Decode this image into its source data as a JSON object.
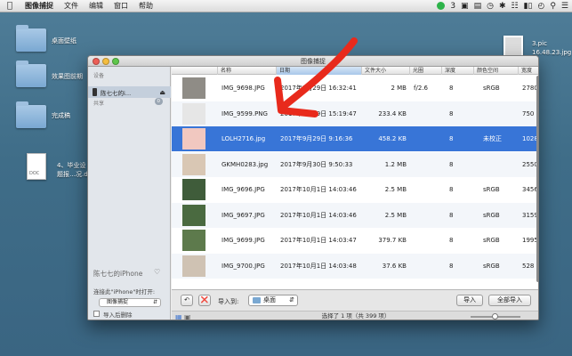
{
  "menubar": {
    "apple": "",
    "items": [
      "图像捕捉",
      "文件",
      "编辑",
      "窗口",
      "帮助"
    ],
    "status_count": "3"
  },
  "desktop": {
    "folders": [
      "桌面壁纸",
      "效果图前期",
      "完成稿"
    ],
    "doc_label_line1": "4、毕业设",
    "doc_label_line2": "题报…况.doc",
    "doc_type": "DOC",
    "screenshot_line1": "3.pic",
    "screenshot_line2": "16.48.23.jpg"
  },
  "window": {
    "title": "图像捕捉",
    "sidebar": {
      "devices_header": "设备",
      "device_name": "陈七七的i…",
      "shared_header": "共享",
      "shared_count": "0",
      "footer_device": "陈七七的iPhone",
      "open_with_label": "连接此\"iPhone\"时打开:",
      "open_with_value": "图像捕捉",
      "delete_after_label": "导入后删除"
    },
    "columns": [
      "名称",
      "日期",
      "文件大小",
      "光圈",
      "深度",
      "颜色空间",
      "宽度"
    ],
    "rows": [
      {
        "name": "IMG_9698.JPG",
        "date": "2017年9月29日 16:32:41",
        "size": "2 MB",
        "aperture": "f/2.6",
        "depth": "8",
        "colorspace": "sRGB",
        "width": "2780",
        "thumb": "#8f8c86"
      },
      {
        "name": "IMG_9599.PNG",
        "date": "2017年9月29日 15:19:47",
        "size": "233.4 KB",
        "aperture": "",
        "depth": "8",
        "colorspace": "",
        "width": "750",
        "thumb": "#e6e6e6"
      },
      {
        "name": "LOLH2716.jpg",
        "date": "2017年9月29日 9:16:36",
        "size": "458.2 KB",
        "aperture": "",
        "depth": "8",
        "colorspace": "未校正",
        "width": "1028",
        "thumb": "#f1c8c0"
      },
      {
        "name": "GKMH0283.jpg",
        "date": "2017年9月30日 9:50:33",
        "size": "1.2 MB",
        "aperture": "",
        "depth": "8",
        "colorspace": "",
        "width": "2550",
        "thumb": "#d9c7b4"
      },
      {
        "name": "IMG_9696.JPG",
        "date": "2017年10月1日 14:03:46",
        "size": "2.5 MB",
        "aperture": "",
        "depth": "8",
        "colorspace": "sRGB",
        "width": "3456",
        "thumb": "#3f5c3a"
      },
      {
        "name": "IMG_9697.JPG",
        "date": "2017年10月1日 14:03:46",
        "size": "2.5 MB",
        "aperture": "",
        "depth": "8",
        "colorspace": "sRGB",
        "width": "3159",
        "thumb": "#4a6a40"
      },
      {
        "name": "IMG_9699.JPG",
        "date": "2017年10月1日 14:03:47",
        "size": "379.7 KB",
        "aperture": "",
        "depth": "8",
        "colorspace": "sRGB",
        "width": "1995",
        "thumb": "#5d7a4c"
      },
      {
        "name": "IMG_9700.JPG",
        "date": "2017年10月1日 14:03:48",
        "size": "37.6 KB",
        "aperture": "",
        "depth": "8",
        "colorspace": "sRGB",
        "width": "528",
        "thumb": "#cfc2b3"
      }
    ],
    "toolbar": {
      "import_to_label": "导入到:",
      "destination": "桌面",
      "import_button": "导入",
      "import_all_button": "全部导入"
    },
    "status": "选择了 1 项（共 399 项）"
  },
  "colors": {
    "selection": "#3875d7",
    "annotation_arrow": "#e82a1c"
  },
  "icons": [
    "apple-icon",
    "wifi-icon",
    "battery-icon",
    "clock-icon",
    "search-icon",
    "list-icon",
    "rotate-icon",
    "delete-icon",
    "phone-icon",
    "folder-icon"
  ]
}
